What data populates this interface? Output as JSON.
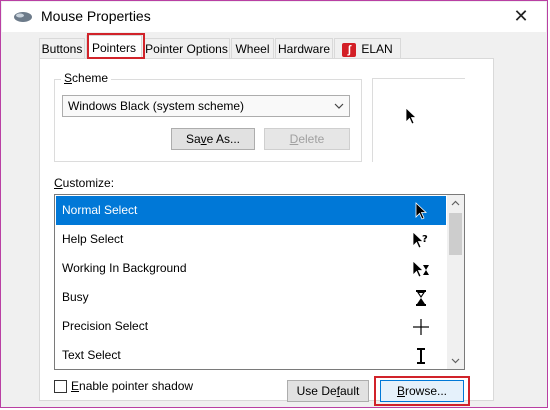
{
  "window": {
    "title": "Mouse Properties",
    "close_glyph": "✕"
  },
  "tabs": [
    {
      "label": "Buttons",
      "active": false
    },
    {
      "label": "Pointers",
      "active": true
    },
    {
      "label": "Pointer Options",
      "active": false
    },
    {
      "label": "Wheel",
      "active": false
    },
    {
      "label": "Hardware",
      "active": false
    },
    {
      "label": "ELAN",
      "active": false,
      "icon": "elan-logo-icon"
    }
  ],
  "scheme": {
    "group_label_first": "S",
    "group_label_rest": "cheme",
    "selected_value": "Windows Black (system scheme)",
    "save_as_label_first": "Sa",
    "save_as_label_u": "v",
    "save_as_label_rest": "e As...",
    "delete_label_first": "",
    "delete_label_u": "D",
    "delete_label_rest": "elete"
  },
  "customize": {
    "label_u": "C",
    "label_rest": "ustomize:",
    "items": [
      {
        "label": "Normal Select",
        "icon": "arrow-cursor-icon",
        "selected": true
      },
      {
        "label": "Help Select",
        "icon": "help-cursor-icon",
        "selected": false
      },
      {
        "label": "Working In Background",
        "icon": "working-cursor-icon",
        "selected": false
      },
      {
        "label": "Busy",
        "icon": "hourglass-cursor-icon",
        "selected": false
      },
      {
        "label": "Precision Select",
        "icon": "crosshair-cursor-icon",
        "selected": false
      },
      {
        "label": "Text Select",
        "icon": "ibeam-cursor-icon",
        "selected": false
      }
    ]
  },
  "footer": {
    "shadow_label_u": "E",
    "shadow_label_rest": "nable pointer shadow",
    "shadow_checked": false,
    "use_default_label_first": "Use De",
    "use_default_label_u": "f",
    "use_default_label_rest": "ault",
    "browse_label_u": "B",
    "browse_label_rest": "rowse..."
  },
  "colors": {
    "selection": "#0078d7",
    "highlight_red": "#d1232a"
  }
}
